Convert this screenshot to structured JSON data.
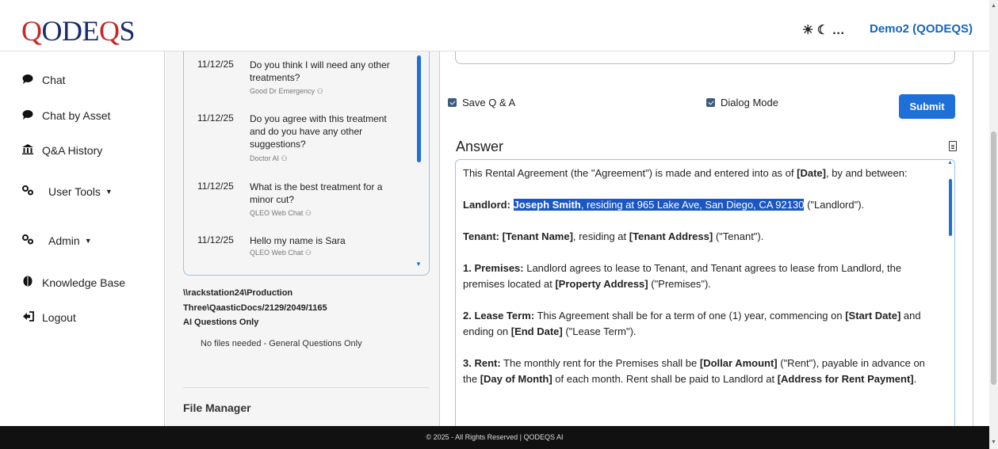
{
  "header": {
    "logo": {
      "q1": "Q",
      "o": "O",
      "de": "DE",
      "q2": "Q",
      "s": "S"
    },
    "theme_icons": "☀ ☾ …",
    "user": "Demo2 (QODEQS)"
  },
  "sidebar": {
    "items": [
      {
        "label": "Chat",
        "icon": "chat-bubble-icon"
      },
      {
        "label": "Chat by Asset",
        "icon": "chat-bubble-icon"
      },
      {
        "label": "Q&A History",
        "icon": "bank-icon"
      },
      {
        "label": "User Tools",
        "icon": "gears-icon"
      },
      {
        "label": "Admin",
        "icon": "gears-icon"
      },
      {
        "label": "Knowledge Base",
        "icon": "brain-icon"
      },
      {
        "label": "Logout",
        "icon": "logout-icon"
      }
    ]
  },
  "history": [
    {
      "date": "11/12/25",
      "question": "Do you think I will need any other treatments?",
      "source": "Good Dr Emergency"
    },
    {
      "date": "11/12/25",
      "question": "Do you agree with this treatment and do you have any other suggestions?",
      "source": "Doctor AI"
    },
    {
      "date": "11/12/25",
      "question": "What is the best treatment for a minor cut?",
      "source": "QLEO Web Chat"
    },
    {
      "date": "11/12/25",
      "question": "Hello my name is Sara",
      "source": "QLEO Web Chat"
    }
  ],
  "path": {
    "line1": "\\\\rackstation24\\Production",
    "line2": "Three\\QaasticDocs/2129/2049/1165"
  },
  "ai_only": "AI Questions Only",
  "no_files": "No files needed - General Questions Only",
  "file_manager": "File Manager",
  "controls": {
    "save_qa": "Save Q & A",
    "dialog_mode": "Dialog Mode",
    "submit": "Submit"
  },
  "answer": {
    "title": "Answer",
    "p1": {
      "a": "This Rental Agreement (the \"Agreement\") is made and entered into as of ",
      "b": "[Date]",
      "c": ", by and between:"
    },
    "p2": {
      "label": "Landlord:",
      "name": "Joseph Smith",
      "addr": ", residing at 965 Lake Ave, San Diego, CA 92130",
      "rest": " (\"Landlord\")."
    },
    "p3": {
      "label": "Tenant: [Tenant Name]",
      "a": ", residing at ",
      "b": "[Tenant Address]",
      "c": " (\"Tenant\")."
    },
    "p4": {
      "label": "1. Premises:",
      "a": " Landlord agrees to lease to Tenant, and Tenant agrees to lease from Landlord, the premises located at ",
      "b": "[Property Address]",
      "c": " (\"Premises\")."
    },
    "p5": {
      "label": "2. Lease Term:",
      "a": " This Agreement shall be for a term of one (1) year, commencing on ",
      "b": "[Start Date]",
      "c": " and ending on ",
      "d": "[End Date]",
      "e": " (\"Lease Term\")."
    },
    "p6": {
      "label": "3. Rent:",
      "a": " The monthly rent for the Premises shall be ",
      "b": "[Dollar Amount]",
      "c": " (\"Rent\"), payable in advance on the ",
      "d": "[Day of Month]",
      "e": " of each month. Rent shall be paid to Landlord at ",
      "f": "[Address for Rent Payment]",
      "g": "."
    }
  },
  "footer": "© 2025 - All Rights Reserved | QODEQS AI",
  "colors": {
    "brand_red": "#c62828",
    "brand_navy": "#1a2d6b",
    "accent_blue": "#1e6fd9",
    "footer_bg": "#111111"
  }
}
